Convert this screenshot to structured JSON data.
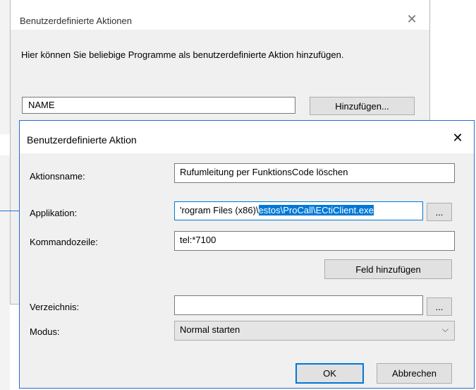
{
  "outer_dialog": {
    "title": "Benutzerdefinierte Aktionen",
    "close_glyph": "✕",
    "description": "Hier können Sie beliebige Programme als benutzerdefinierte Aktion hinzufügen.",
    "name_value": "NAME",
    "add_button": "Hinzufügen..."
  },
  "inner_dialog": {
    "title": "Benutzerdefinierte Aktion",
    "close_glyph": "✕",
    "action_name_label": "Aktionsname:",
    "action_name_value": "Rufumleitung per FunktionsCode löschen",
    "application_label": "Applikation:",
    "application_value_plain": "'rogram Files (x86)\\",
    "application_value_selected": "estos\\ProCall\\ECtiClient.exe",
    "browse_label": "...",
    "commandline_label": "Kommandozeile:",
    "commandline_value": "tel:*7100",
    "add_field_button": "Feld hinzufügen",
    "directory_label": "Verzeichnis:",
    "directory_value": "",
    "mode_label": "Modus:",
    "mode_value": "Normal starten",
    "chevron_glyph": "⌵",
    "ok_button": "OK",
    "cancel_button": "Abbrechen"
  },
  "colors": {
    "accent": "#0078d7",
    "dialog_bg": "#f0f0f0",
    "button_bg": "#e1e1e1"
  }
}
